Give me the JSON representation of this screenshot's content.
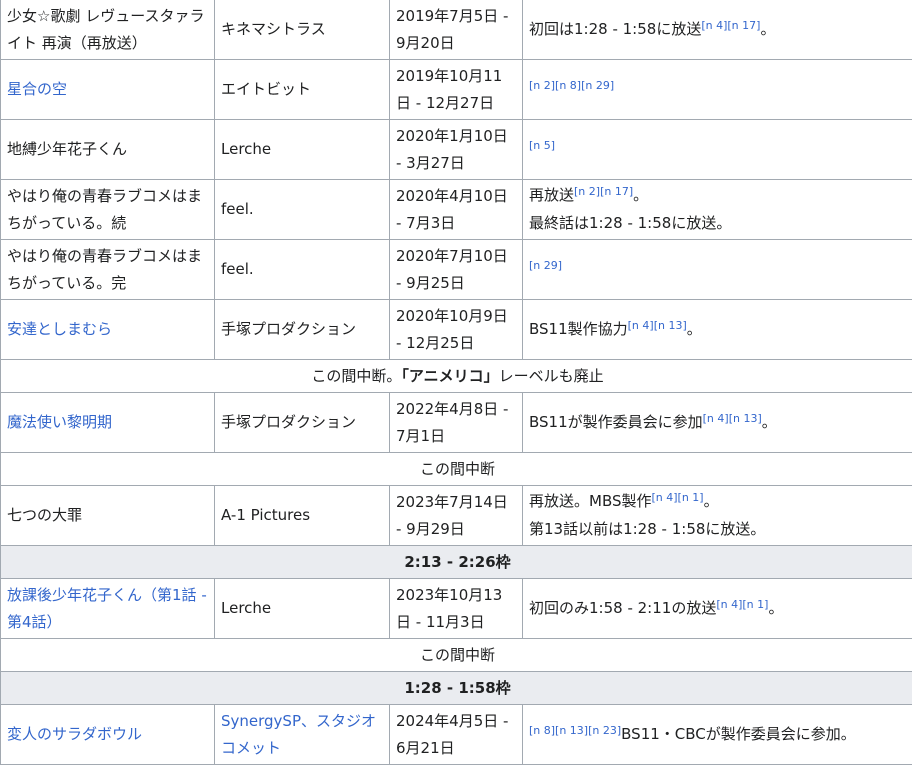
{
  "rows": [
    {
      "type": "show",
      "title": "少女☆歌劇 レヴュースタァライト 再演（再放送）",
      "link": false,
      "studio": "キネマシトラス",
      "studio_link": false,
      "date": "2019年7月5日 - 9月20日",
      "note_pre": "初回は1:28 - 1:58に放送",
      "refs": "[n 4][n 17]",
      "note_post": "。",
      "note_line2": ""
    },
    {
      "type": "show",
      "title": "星合の空",
      "link": true,
      "studio": "エイトビット",
      "studio_link": false,
      "date": "2019年10月11日 - 12月27日",
      "note_pre": "",
      "refs": "[n 2][n 8][n 29]",
      "note_post": "",
      "note_line2": ""
    },
    {
      "type": "show",
      "title": "地縛少年花子くん",
      "link": false,
      "studio": "Lerche",
      "studio_link": false,
      "date": "2020年1月10日 - 3月27日",
      "note_pre": "",
      "refs": "[n 5]",
      "note_post": "",
      "note_line2": ""
    },
    {
      "type": "show",
      "title": "やはり俺の青春ラブコメはまちがっている。続",
      "link": false,
      "studio": "feel.",
      "studio_link": false,
      "date": "2020年4月10日 - 7月3日",
      "note_pre": "再放送",
      "refs": "[n 2][n 17]",
      "note_post": "。",
      "note_line2": "最終話は1:28 - 1:58に放送。"
    },
    {
      "type": "show",
      "title": "やはり俺の青春ラブコメはまちがっている。完",
      "link": false,
      "studio": "feel.",
      "studio_link": false,
      "date": "2020年7月10日 - 9月25日",
      "note_pre": "",
      "refs": "[n 29]",
      "note_post": "",
      "note_line2": ""
    },
    {
      "type": "show",
      "title": "安達としまむら",
      "link": true,
      "studio": "手塚プロダクション",
      "studio_link": false,
      "date": "2020年10月9日 - 12月25日",
      "note_pre": "BS11製作協力",
      "refs": "[n 4][n 13]",
      "note_post": "。",
      "note_line2": ""
    },
    {
      "type": "note_bold",
      "pre": "この間中断。",
      "bold": "「アニメリコ」",
      "post": "レーベルも廃止"
    },
    {
      "type": "show",
      "title": "魔法使い黎明期",
      "link": true,
      "studio": "手塚プロダクション",
      "studio_link": false,
      "date": "2022年4月8日 - 7月1日",
      "note_pre": "BS11が製作委員会に参加",
      "refs": "[n 4][n 13]",
      "note_post": "。",
      "note_line2": ""
    },
    {
      "type": "note",
      "text": "この間中断"
    },
    {
      "type": "show",
      "title": "七つの大罪",
      "link": false,
      "studio": "A-1 Pictures",
      "studio_link": false,
      "date": "2023年7月14日 - 9月29日",
      "note_pre": "再放送。MBS製作",
      "refs": "[n 4][n 1]",
      "note_post": "。",
      "note_line2": "第13話以前は1:28 - 1:58に放送。"
    },
    {
      "type": "slot",
      "text": "2:13 - 2:26枠"
    },
    {
      "type": "show",
      "title": "放課後少年花子くん（第1話 - 第4話）",
      "link": true,
      "studio": "Lerche",
      "studio_link": false,
      "date": "2023年10月13日 - 11月3日",
      "note_pre": "初回のみ1:58 - 2:11の放送",
      "refs": "[n 4][n 1]",
      "note_post": "。",
      "note_line2": ""
    },
    {
      "type": "note",
      "text": "この間中断"
    },
    {
      "type": "slot",
      "text": "1:28 - 1:58枠"
    },
    {
      "type": "show",
      "title": "変人のサラダボウル",
      "link": true,
      "studio": "SynergySP、スタジオコメット",
      "studio_link": true,
      "date": "2024年4月5日 - 6月21日",
      "note_pre": "",
      "refs": "[n 8][n 13][n 23]",
      "note_post": "BS11・CBCが製作委員会に参加。",
      "note_line2": ""
    }
  ]
}
